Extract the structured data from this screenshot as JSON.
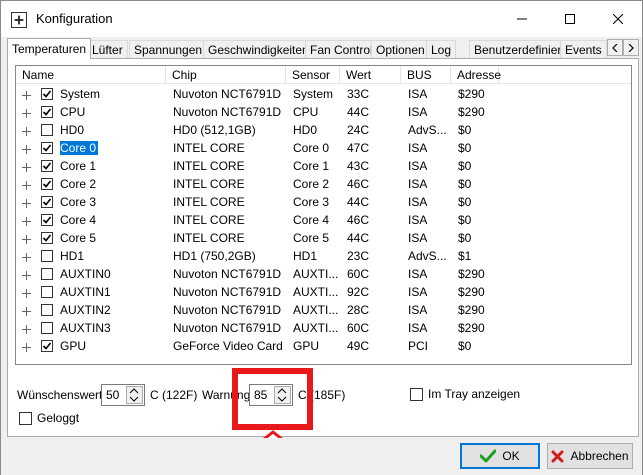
{
  "window": {
    "title": "Konfiguration"
  },
  "tabs": [
    {
      "label": "Temperaturen",
      "active": true
    },
    {
      "label": "Lüfter"
    },
    {
      "label": "Spannungen"
    },
    {
      "label": "Geschwindigkeiten"
    },
    {
      "label": "Fan Control"
    },
    {
      "label": "Optionen"
    },
    {
      "label": "Log"
    },
    {
      "label": "Benutzerdefiniert"
    },
    {
      "label": "Events"
    }
  ],
  "table": {
    "columns": [
      "Name",
      "Chip",
      "Sensor",
      "Wert",
      "BUS",
      "Adresse"
    ],
    "rows": [
      {
        "name": "System",
        "chip": "Nuvoton NCT6791D",
        "sensor": "System",
        "wert": "33C",
        "bus": "ISA",
        "adresse": "$290",
        "checked": true
      },
      {
        "name": "CPU",
        "chip": "Nuvoton NCT6791D",
        "sensor": "CPU",
        "wert": "44C",
        "bus": "ISA",
        "adresse": "$290",
        "checked": true
      },
      {
        "name": "HD0",
        "chip": "HD0 (512,1GB)",
        "sensor": "HD0",
        "wert": "24C",
        "bus": "AdvS...",
        "adresse": "$0",
        "checked": false
      },
      {
        "name": "Core 0",
        "chip": "INTEL CORE",
        "sensor": "Core 0",
        "wert": "47C",
        "bus": "ISA",
        "adresse": "$0",
        "checked": true,
        "selected": true
      },
      {
        "name": "Core 1",
        "chip": "INTEL CORE",
        "sensor": "Core 1",
        "wert": "43C",
        "bus": "ISA",
        "adresse": "$0",
        "checked": true
      },
      {
        "name": "Core 2",
        "chip": "INTEL CORE",
        "sensor": "Core 2",
        "wert": "46C",
        "bus": "ISA",
        "adresse": "$0",
        "checked": true
      },
      {
        "name": "Core 3",
        "chip": "INTEL CORE",
        "sensor": "Core 3",
        "wert": "44C",
        "bus": "ISA",
        "adresse": "$0",
        "checked": true
      },
      {
        "name": "Core 4",
        "chip": "INTEL CORE",
        "sensor": "Core 4",
        "wert": "46C",
        "bus": "ISA",
        "adresse": "$0",
        "checked": true
      },
      {
        "name": "Core 5",
        "chip": "INTEL CORE",
        "sensor": "Core 5",
        "wert": "44C",
        "bus": "ISA",
        "adresse": "$0",
        "checked": true
      },
      {
        "name": "HD1",
        "chip": "HD1 (750,2GB)",
        "sensor": "HD1",
        "wert": "23C",
        "bus": "AdvS...",
        "adresse": "$1",
        "checked": false
      },
      {
        "name": "AUXTIN0",
        "chip": "Nuvoton NCT6791D",
        "sensor": "AUXTI...",
        "wert": "60C",
        "bus": "ISA",
        "adresse": "$290",
        "checked": false
      },
      {
        "name": "AUXTIN1",
        "chip": "Nuvoton NCT6791D",
        "sensor": "AUXTI...",
        "wert": "92C",
        "bus": "ISA",
        "adresse": "$290",
        "checked": false
      },
      {
        "name": "AUXTIN2",
        "chip": "Nuvoton NCT6791D",
        "sensor": "AUXTI...",
        "wert": "28C",
        "bus": "ISA",
        "adresse": "$290",
        "checked": false
      },
      {
        "name": "AUXTIN3",
        "chip": "Nuvoton NCT6791D",
        "sensor": "AUXTI...",
        "wert": "60C",
        "bus": "ISA",
        "adresse": "$290",
        "checked": false
      },
      {
        "name": "GPU",
        "chip": "GeForce Video Card",
        "sensor": "GPU",
        "wert": "49C",
        "bus": "PCI",
        "adresse": "$0",
        "checked": true
      }
    ]
  },
  "settings": {
    "wunschenswert_label": "Wünschenswert",
    "wunschenswert_value": "50",
    "wunschenswert_unit": "C (122F)",
    "warnung_label": "Warnung",
    "warnung_value": "85",
    "warnung_unit": "C (185F)",
    "tray_label": "Im Tray anzeigen",
    "geloggt_label": "Geloggt"
  },
  "buttons": {
    "ok": "OK",
    "cancel": "Abbrechen"
  },
  "colors": {
    "highlight": "#e8191b",
    "selection": "#0078d7",
    "ok_check": "#1e9e1e",
    "cancel_x": "#d11a1a"
  }
}
